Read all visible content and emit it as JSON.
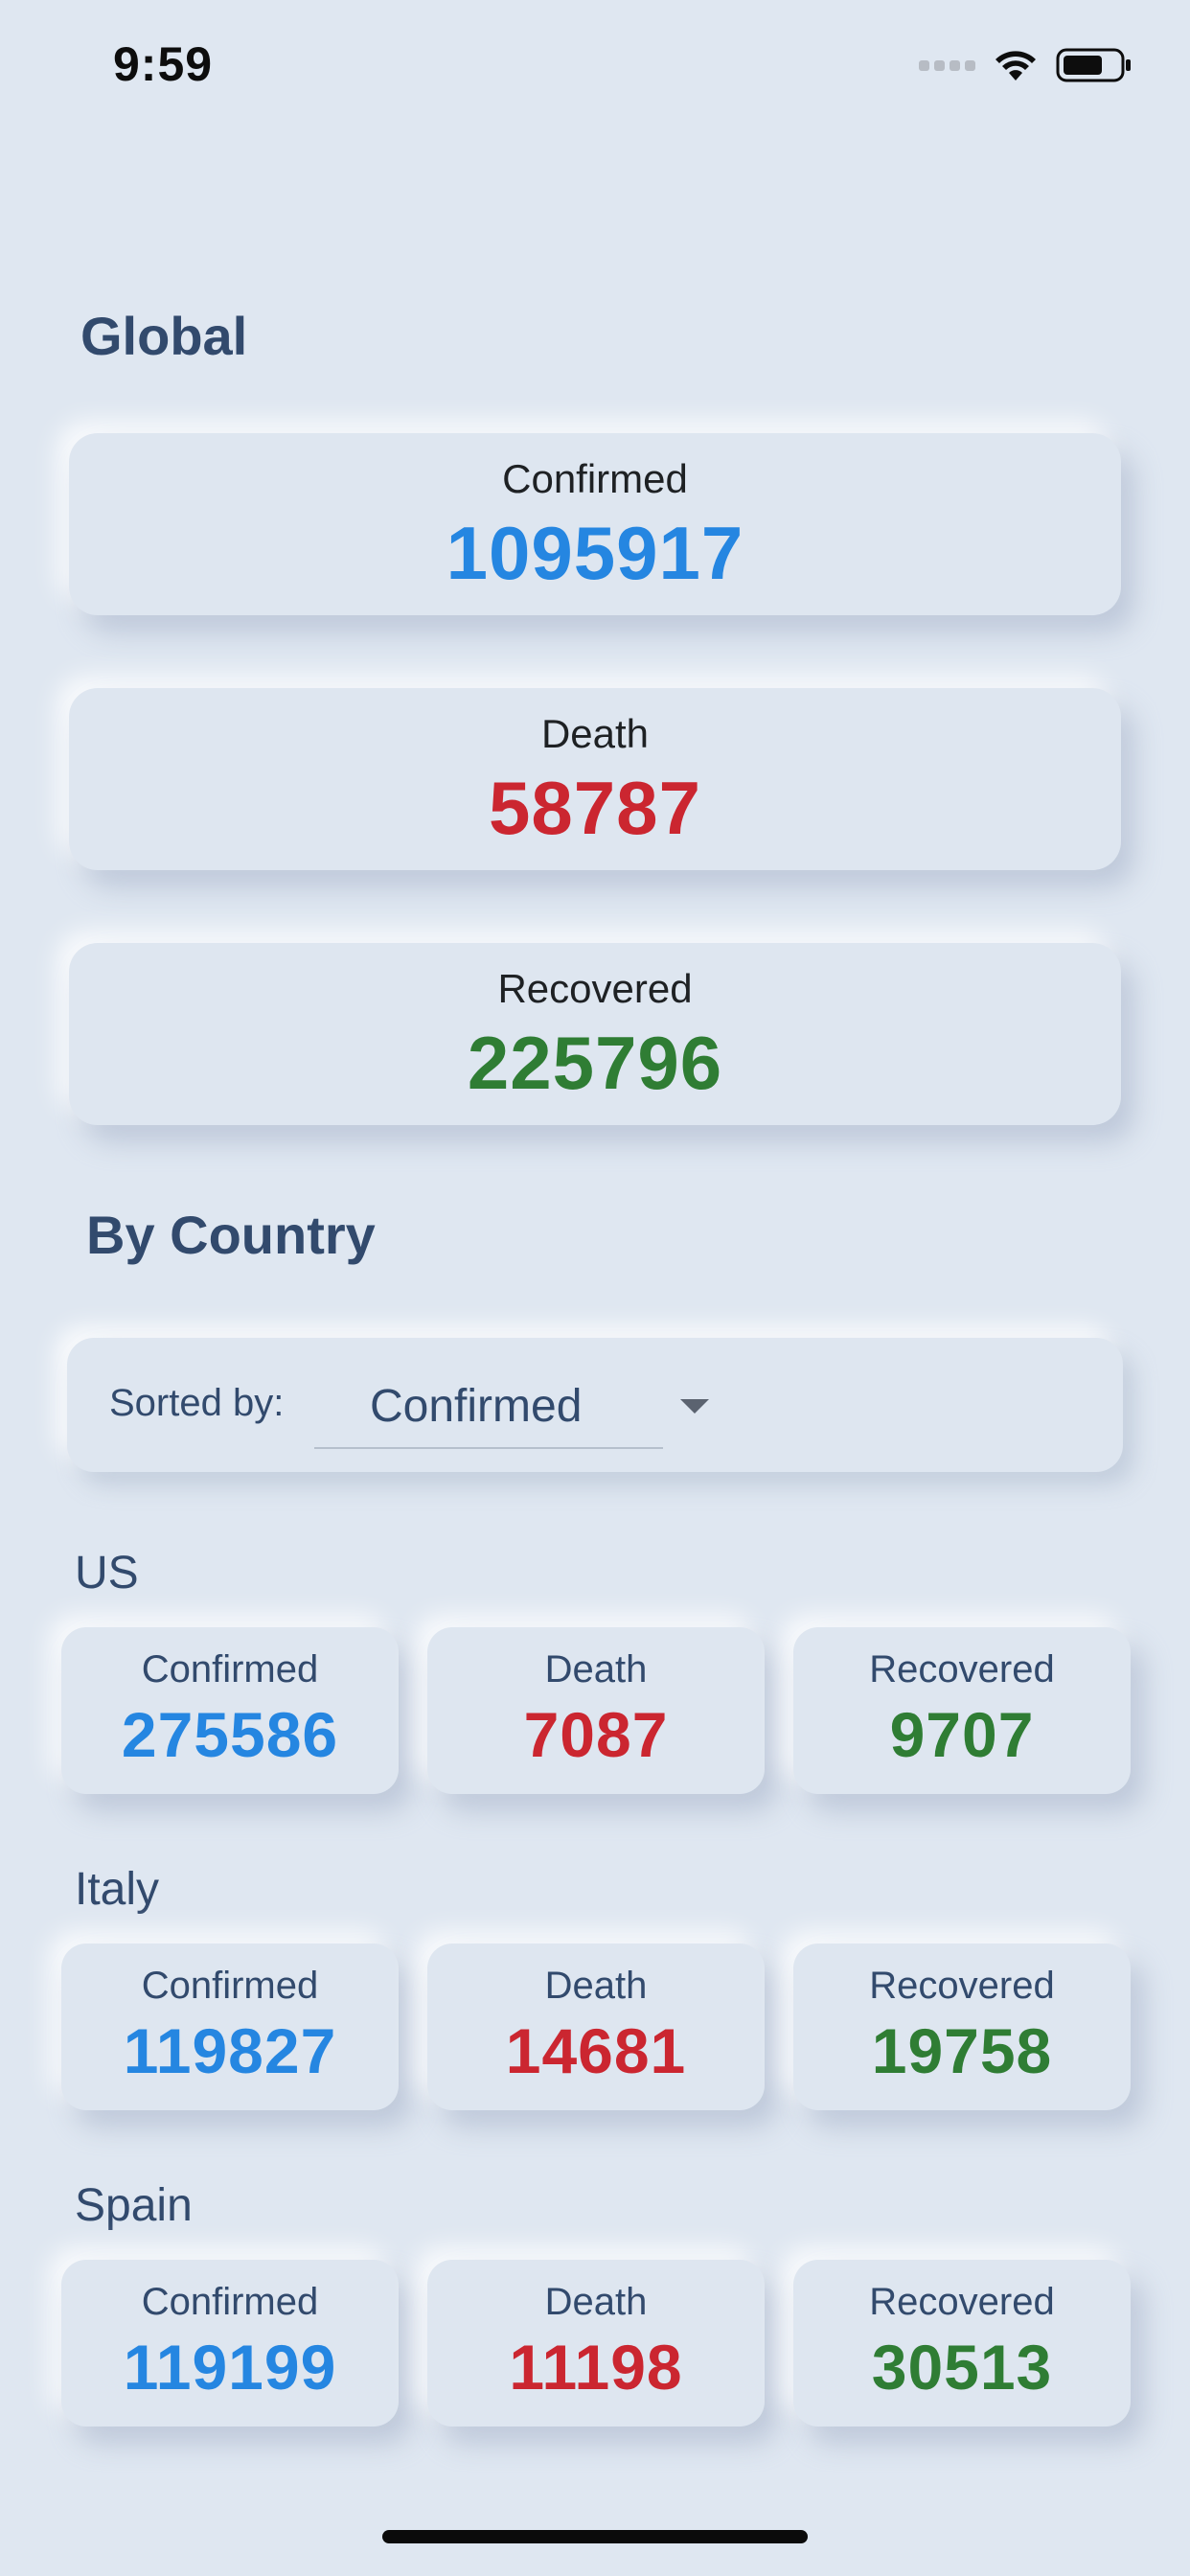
{
  "status_bar": {
    "time": "9:59"
  },
  "global": {
    "title": "Global",
    "confirmed": {
      "label": "Confirmed",
      "value": "1095917"
    },
    "death": {
      "label": "Death",
      "value": "58787"
    },
    "recovered": {
      "label": "Recovered",
      "value": "225796"
    }
  },
  "by_country": {
    "title": "By Country",
    "sort_label": "Sorted by:",
    "sort_value": "Confirmed",
    "countries": [
      {
        "name": "US",
        "confirmed": "275586",
        "death": "7087",
        "recovered": "9707"
      },
      {
        "name": "Italy",
        "confirmed": "119827",
        "death": "14681",
        "recovered": "19758"
      },
      {
        "name": "Spain",
        "confirmed": "119199",
        "death": "11198",
        "recovered": "30513"
      }
    ],
    "labels": {
      "confirmed": "Confirmed",
      "death": "Death",
      "recovered": "Recovered"
    }
  },
  "colors": {
    "background": "#dfe7f1",
    "confirmed": "#2586e1",
    "death": "#cb2630",
    "recovered": "#2f7d34",
    "heading": "#324a6d"
  },
  "icons": [
    "signal-icon",
    "wifi-icon",
    "battery-icon",
    "dropdown-arrow-icon"
  ]
}
